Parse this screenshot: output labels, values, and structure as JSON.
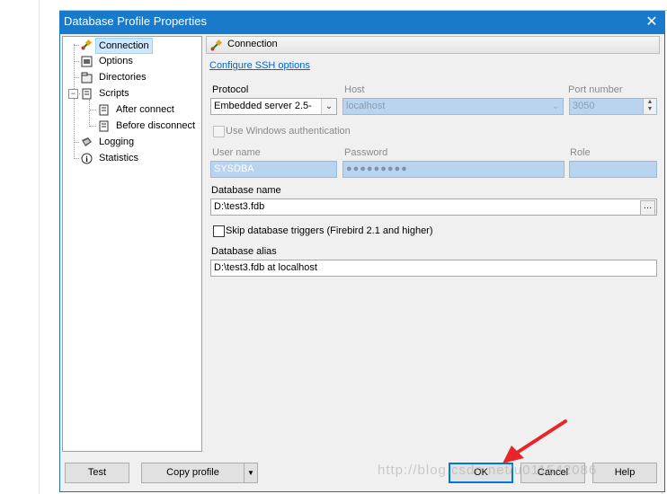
{
  "window": {
    "title": "Database Profile Properties"
  },
  "tree": {
    "items": [
      {
        "label": "Connection",
        "icon": "connection-plug-icon",
        "selected": true
      },
      {
        "label": "Options",
        "icon": "options-icon"
      },
      {
        "label": "Directories",
        "icon": "directories-icon"
      },
      {
        "label": "Scripts",
        "icon": "scripts-icon",
        "expanded": true
      },
      {
        "label": "After connect",
        "icon": "script-icon"
      },
      {
        "label": "Before disconnect",
        "icon": "script-icon"
      },
      {
        "label": "Logging",
        "icon": "logging-icon"
      },
      {
        "label": "Statistics",
        "icon": "info-icon"
      }
    ]
  },
  "panel": {
    "title": "Connection",
    "ssh_link": "Configure SSH options",
    "protocol_label": "Protocol",
    "protocol_value": "Embedded server 2.5-",
    "host_label": "Host",
    "host_value": "localhost",
    "port_label": "Port number",
    "port_value": "3050",
    "windows_auth_label": "Use Windows authentication",
    "username_label": "User name",
    "username_value": "SYSDBA",
    "password_label": "Password",
    "password_value": "●●●●●●●●●",
    "role_label": "Role",
    "role_value": "",
    "dbname_label": "Database name",
    "dbname_value": "D:\\test3.fdb",
    "skip_triggers_label": "Skip database triggers (Firebird 2.1 and higher)",
    "alias_label": "Database alias",
    "alias_value": "D:\\test3.fdb at localhost"
  },
  "buttons": {
    "test": "Test",
    "copy_profile": "Copy profile",
    "ok": "OK",
    "cancel": "Cancel",
    "help": "Help"
  },
  "watermark": "http://blog.csdn.net/u011542086",
  "colors": {
    "titlebar": "#1979ca",
    "selection": "#cce8ff",
    "disabled_field": "#b9d4ef",
    "arrow": "#e8262a"
  }
}
